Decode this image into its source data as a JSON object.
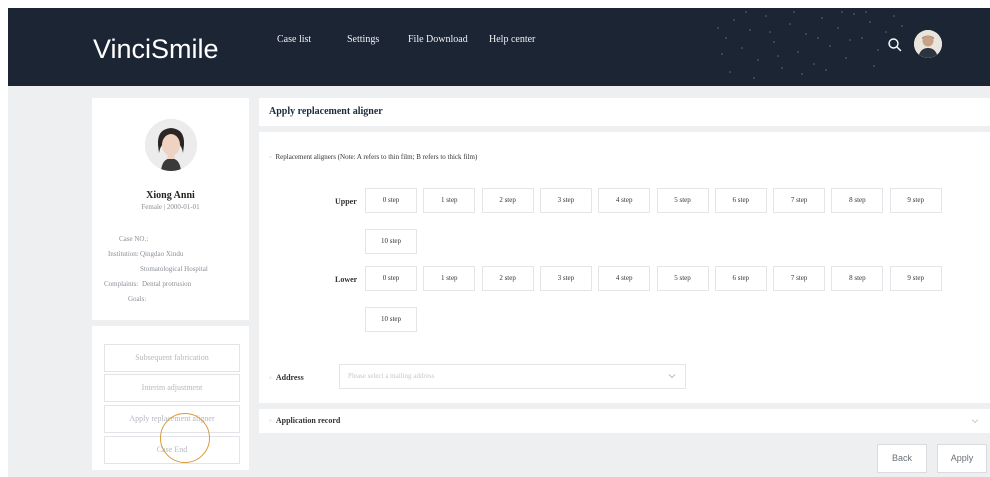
{
  "brand": {
    "logo_text": "VinciSmile",
    "header_bg": "#1b2533",
    "accent": "#0e8fd6"
  },
  "nav": {
    "items": [
      {
        "label": "Case list"
      },
      {
        "label": "Settings"
      },
      {
        "label": "File Download"
      },
      {
        "label": "Help center"
      }
    ],
    "search_icon": "search-icon",
    "user_avatar": "user-avatar"
  },
  "patient": {
    "name": "Xiong Anni",
    "meta": "Female | 2000-01-01",
    "case_no_label": "Case NO.:",
    "institution_label": "Institution:",
    "institution_line1": "Qingdao Xindu",
    "institution_line2": "Stomatological Hospital",
    "complaints_label": "Complaints:",
    "complaints_value": "Dental protrusion",
    "goals_label": "Goals:"
  },
  "actions": [
    {
      "label": "Subsequent fabrication"
    },
    {
      "label": "Interim adjustment"
    },
    {
      "label": "Apply replacement aligner"
    },
    {
      "label": "Case End"
    }
  ],
  "page": {
    "title": "Apply replacement aligner"
  },
  "form": {
    "note": "Replacement aligners (Note: A refers to thin film; B refers to thick film)",
    "upper_label": "Upper",
    "lower_label": "Lower",
    "upper_steps": [
      "0 step",
      "1 step",
      "2 step",
      "3 step",
      "4 step",
      "5 step",
      "6 step",
      "7 step",
      "8 step",
      "9 step",
      "10 step"
    ],
    "lower_steps": [
      "0 step",
      "1 step",
      "2 step",
      "3 step",
      "4 step",
      "5 step",
      "6 step",
      "7 step",
      "8 step",
      "9 step",
      "10 step"
    ],
    "address_label": "Address",
    "address_placeholder": "Please select a mailing address",
    "record_label": "Application record"
  },
  "footer": {
    "back_label": "Back",
    "apply_label": "Apply"
  },
  "colors": {
    "highlight_ring": "#d99a3a"
  }
}
